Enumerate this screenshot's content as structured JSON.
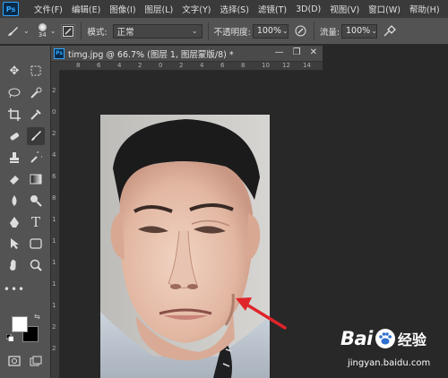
{
  "app": {
    "logo_text": "Ps"
  },
  "menu": [
    "文件(F)",
    "编辑(E)",
    "图像(I)",
    "图层(L)",
    "文字(Y)",
    "选择(S)",
    "滤镜(T)",
    "3D(D)",
    "视图(V)",
    "窗口(W)",
    "帮助(H)"
  ],
  "options": {
    "brush_size": "34",
    "mode_label": "模式:",
    "mode_value": "正常",
    "opacity_label": "不透明度:",
    "opacity_value": "100%",
    "flow_label": "流量:",
    "flow_value": "100%"
  },
  "document": {
    "logo_text": "Ps",
    "title": "timg.jpg @ 66.7% (图层 1, 图层蒙版/8) *",
    "controls": [
      "—",
      "❐",
      "✕"
    ]
  },
  "rulers": {
    "top": [
      "8",
      "6",
      "4",
      "2",
      "0",
      "2",
      "4",
      "6",
      "8",
      "10",
      "12",
      "14"
    ],
    "left": [
      "2",
      "0",
      "2",
      "4",
      "6",
      "8",
      "1",
      "1",
      "1",
      "1",
      "1",
      "2",
      "2"
    ]
  },
  "colors": {
    "foreground": "#ffffff",
    "background": "#000000",
    "arrow": "#e0242a",
    "ps_blue": "#31a8ff"
  },
  "watermark": {
    "brand": "Bai",
    "brand_cn": "经验",
    "url": "jingyan.baidu.com"
  }
}
